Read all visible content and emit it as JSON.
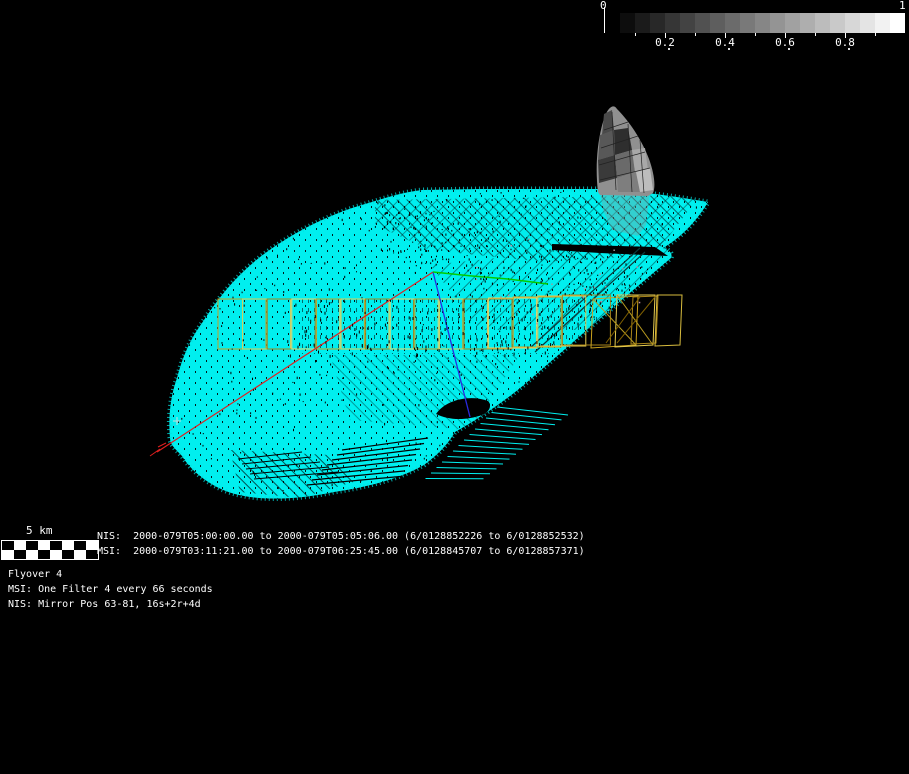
{
  "window": {
    "background": "#000000"
  },
  "colorbar": {
    "min_label": "0",
    "max_label": "1",
    "ticks": [
      "0.2",
      "0.4",
      "0.6",
      "0.8"
    ],
    "steps": 20,
    "min_color": "#000000",
    "max_color": "#ffffff"
  },
  "scalebar": {
    "label": "5 km"
  },
  "status": {
    "nis_line": "NIS:  2000-079T05:00:00.00 to 2000-079T05:05:06.00 (6/0128852226 to 6/0128852532)",
    "msi_line": "MSI:  2000-079T03:11:21.00 to 2000-079T06:25:45.00 (6/0128845707 to 6/0128857371)"
  },
  "annotations": {
    "line1": "Flyover 4",
    "line2": "MSI: One Filter 4 every 66 seconds",
    "line3": "NIS: Mirror Pos 63-81, 16s+2r+4d"
  },
  "scene": {
    "mesh_color": "#00efef",
    "footprint_palette": [
      "#caa21e",
      "#e6cc52",
      "#a8841a",
      "#ecd86a"
    ],
    "red_line_color": "#e02020",
    "blue_line_color": "#2a2ae0",
    "green_line_color": "#00cc00",
    "shaded_region_color": "#8a8a8a",
    "marker_color": "#cfd8d8"
  }
}
